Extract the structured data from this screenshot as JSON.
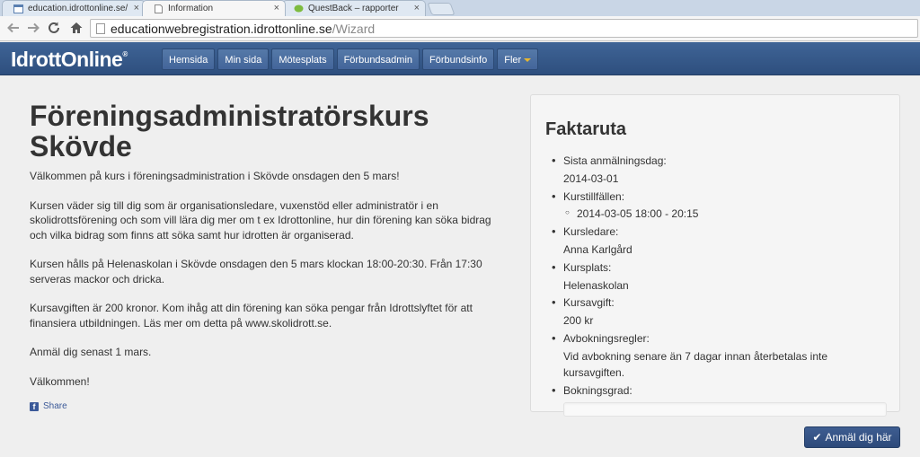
{
  "browser": {
    "tabs": [
      {
        "title": "education.idrottonline.se/",
        "active": false
      },
      {
        "title": "Information",
        "active": true
      },
      {
        "title": "QuestBack – rapporter",
        "active": false
      }
    ],
    "close_glyph": "×",
    "url_host": "educationwebregistration.idrottonline.se",
    "url_path": "/Wizard",
    "icons": {
      "back": "arrow-left-icon",
      "forward": "arrow-right-icon",
      "reload": "reload-icon",
      "home": "home-icon"
    }
  },
  "site": {
    "logo": "IdrottOnline",
    "logo_mark": "®",
    "nav": [
      "Hemsida",
      "Min sida",
      "Mötesplats",
      "Förbundsadmin",
      "Förbundsinfo",
      "Fler"
    ],
    "nav_color": "#2e4f7e"
  },
  "main": {
    "title": "Föreningsadministratörskurs Skövde",
    "paragraphs": [
      "Välkommen på kurs i föreningsadministration i Skövde onsdagen den 5 mars!",
      "Kursen väder sig till dig som är organisationsledare, vuxenstöd eller administratör i en skolidrottsförening och som vill lära dig mer om t ex Idrottonline, hur din förening kan söka bidrag och vilka bidrag som finns att söka samt hur idrotten är organiserad.",
      "Kursen hålls på Helenaskolan i Skövde onsdagen den 5 mars klockan 18:00-20:30. Från 17:30 serveras mackor och dricka.",
      "Kursavgiften är 200 kronor. Kom ihåg att din förening kan söka pengar från Idrottslyftet för att finansiera utbildningen. Läs mer om detta på www.skolidrott.se.",
      "Anmäl dig senast 1 mars.",
      "Välkommen!"
    ],
    "share_label": "Share",
    "share_icon": "f"
  },
  "fakta": {
    "title": "Faktaruta",
    "items": {
      "deadline_label": "Sista anmälningsdag:",
      "deadline_value": "2014-03-01",
      "sessions_label": "Kurstillfällen:",
      "session_1": "2014-03-05 18:00 - 20:15",
      "leader_label": "Kursledare:",
      "leader_value": "Anna Karlgård",
      "place_label": "Kursplats:",
      "place_value": "Helenaskolan",
      "fee_label": "Kursavgift:",
      "fee_value": "200 kr",
      "cancel_label": "Avbokningsregler:",
      "cancel_value": "Vid avbokning senare än 7 dagar innan återbetalas inte kursavgiften.",
      "booking_label": "Bokningsgrad:"
    },
    "booking_fraction": 0
  },
  "cta": {
    "label": "Anmäl dig här",
    "icon": "✔"
  }
}
